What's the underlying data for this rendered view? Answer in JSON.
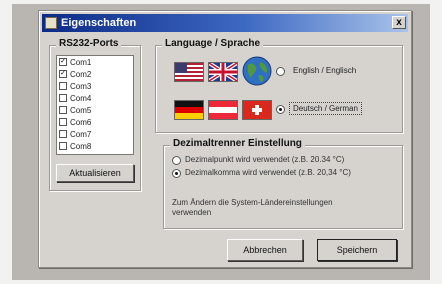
{
  "window": {
    "title": "Eigenschaften",
    "close_glyph": "x"
  },
  "ports": {
    "label": "RS232-Ports",
    "items": [
      {
        "label": "Com1",
        "checked": true
      },
      {
        "label": "Com2",
        "checked": true
      },
      {
        "label": "Com3",
        "checked": false
      },
      {
        "label": "Com4",
        "checked": false
      },
      {
        "label": "Com5",
        "checked": false
      },
      {
        "label": "Com6",
        "checked": false
      },
      {
        "label": "Com7",
        "checked": false
      },
      {
        "label": "Com8",
        "checked": false
      }
    ],
    "refresh_button": "Aktualisieren"
  },
  "language": {
    "label": "Language / Sprache",
    "option_english": "English / Englisch",
    "option_german": "Deutsch / German",
    "selected": "german"
  },
  "decimal": {
    "label": "Dezimaltrenner Einstellung",
    "option_point": "Dezimalpunkt wird verwendet (z.B. 20.34 °C)",
    "option_comma": "Dezimalkomma wird verwendet (z.B. 20,34 °C)",
    "selected": "comma",
    "hint": "Zum Ändern die System-Ländereinstellungen verwenden"
  },
  "footer": {
    "cancel_button": "Abbrechen",
    "save_button": "Speichern"
  }
}
